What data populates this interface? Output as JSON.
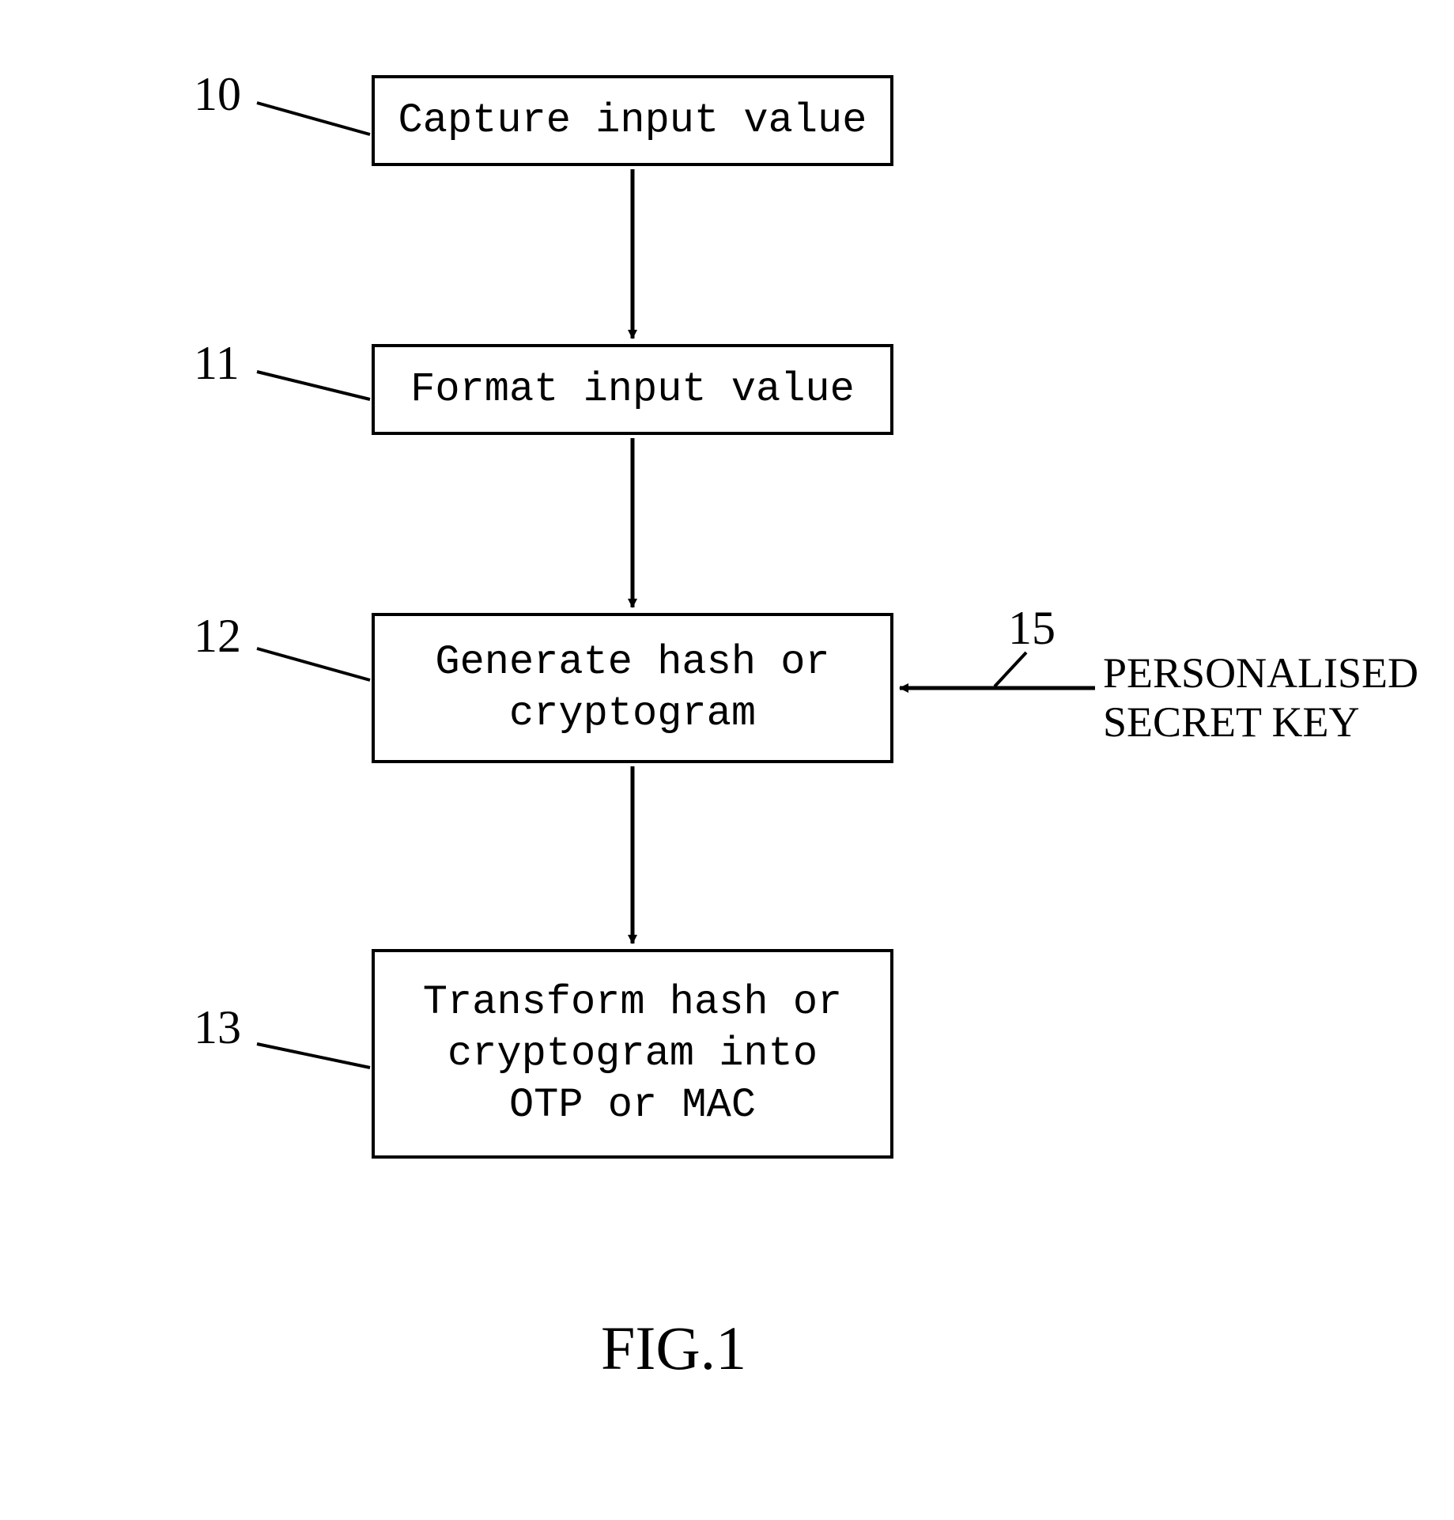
{
  "boxes": {
    "b10": {
      "ref": "10",
      "text": "Capture input value"
    },
    "b11": {
      "ref": "11",
      "text": "Format input value"
    },
    "b12": {
      "ref": "12",
      "text": "Generate hash or\ncryptogram"
    },
    "b13": {
      "ref": "13",
      "text": "Transform hash or\ncryptogram into\nOTP or MAC"
    }
  },
  "side_input": {
    "ref": "15",
    "text": "PERSONALISED\nSECRET KEY"
  },
  "figure_caption": "FIG.1"
}
